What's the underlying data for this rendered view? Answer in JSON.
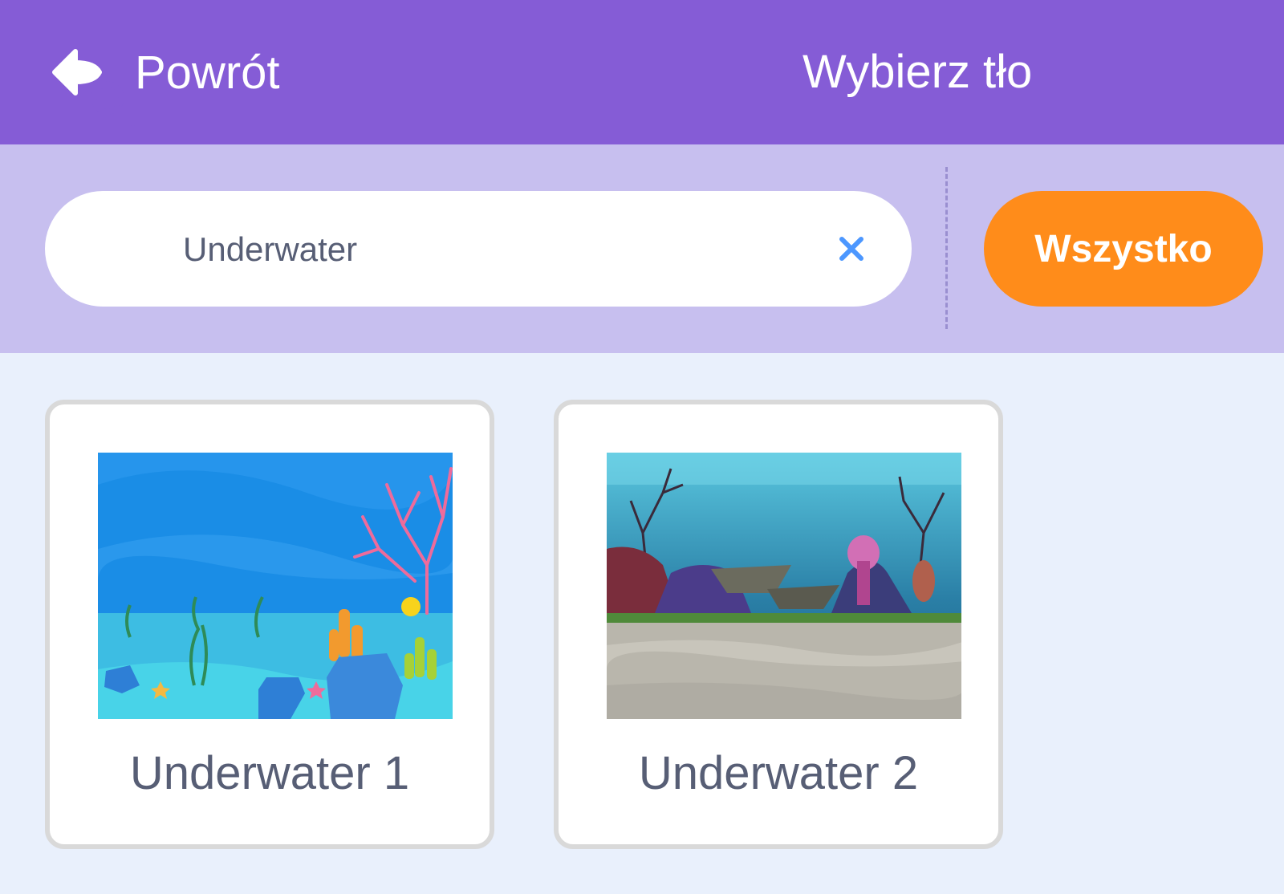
{
  "header": {
    "back_label": "Powrót",
    "title": "Wybierz tło"
  },
  "search": {
    "value": "Underwater"
  },
  "tags": {
    "all_label": "Wszystko"
  },
  "items": [
    {
      "name": "Underwater 1"
    },
    {
      "name": "Underwater 2"
    }
  ],
  "colors": {
    "header": "#855cd6",
    "filter_bar": "#c7bfef",
    "background": "#e9f0fc",
    "tag_active": "#ff8c1a",
    "text": "#575e75"
  }
}
